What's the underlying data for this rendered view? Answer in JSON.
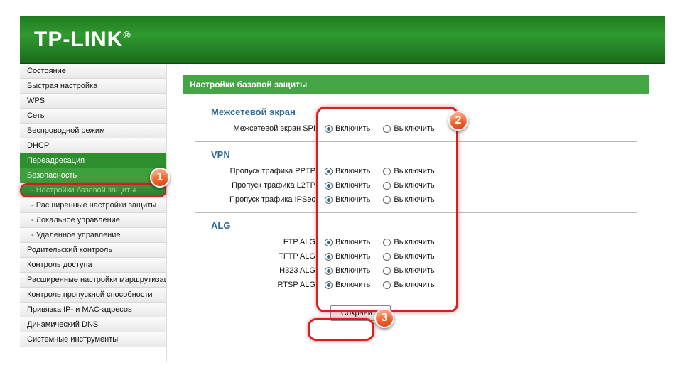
{
  "brand": "TP-LINK",
  "sidebar": {
    "items": [
      {
        "label": "Состояние"
      },
      {
        "label": "Быстрая настройка"
      },
      {
        "label": "WPS"
      },
      {
        "label": "Сеть"
      },
      {
        "label": "Беспроводной режим"
      },
      {
        "label": "DHCP"
      },
      {
        "label": "Переадресация"
      },
      {
        "label": "Безопасность"
      },
      {
        "label": "- Настройки базовой защиты"
      },
      {
        "label": "- Расширенные настройки защиты"
      },
      {
        "label": "- Локальное управление"
      },
      {
        "label": "- Удаленное управление"
      },
      {
        "label": "Родительский контроль"
      },
      {
        "label": "Контроль доступа"
      },
      {
        "label": "Расширенные настройки маршрутизации"
      },
      {
        "label": "Контроль пропускной способности"
      },
      {
        "label": "Привязка IP- и MAC-адресов"
      },
      {
        "label": "Динамический DNS"
      },
      {
        "label": "Системные инструменты"
      }
    ]
  },
  "content": {
    "title": "Настройки базовой защиты",
    "radio_on": "Включить",
    "radio_off": "Выключить",
    "sections": [
      {
        "heading": "Межсетевой экран",
        "rows": [
          {
            "label": "Межсетевой экран SPI:",
            "selected": "on"
          }
        ]
      },
      {
        "heading": "VPN",
        "rows": [
          {
            "label": "Пропуск трафика PPTP:",
            "selected": "on"
          },
          {
            "label": "Пропуск трафика L2TP:",
            "selected": "on"
          },
          {
            "label": "Пропуск трафика IPSec:",
            "selected": "on"
          }
        ]
      },
      {
        "heading": "ALG",
        "rows": [
          {
            "label": "FTP ALG:",
            "selected": "on"
          },
          {
            "label": "TFTP ALG:",
            "selected": "on"
          },
          {
            "label": "H323 ALG:",
            "selected": "on"
          },
          {
            "label": "RTSP ALG:",
            "selected": "on"
          }
        ]
      }
    ],
    "save_label": "Сохранить"
  },
  "annotations": {
    "c1": "1",
    "c2": "2",
    "c3": "3"
  }
}
